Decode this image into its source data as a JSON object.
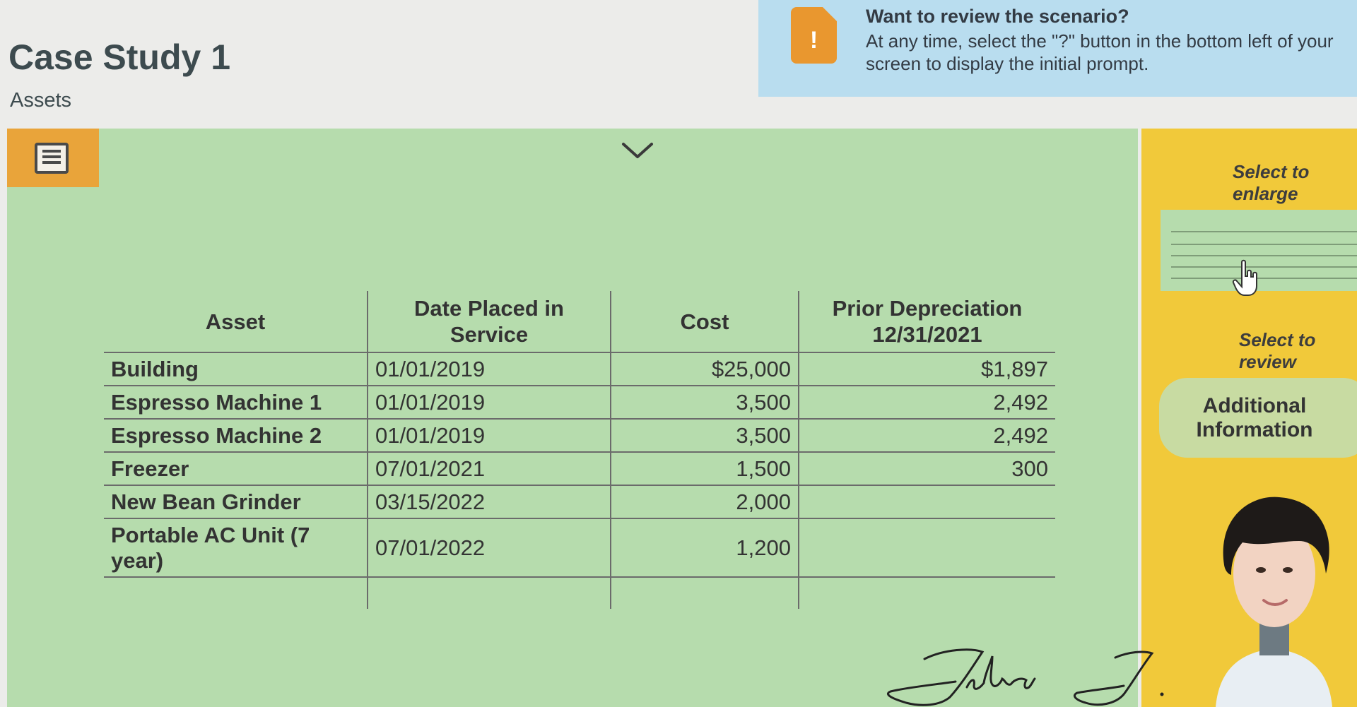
{
  "header": {
    "title": "Case Study 1",
    "subtitle": "Assets"
  },
  "notice": {
    "icon": "alert-document-icon",
    "icon_glyph": "!",
    "title": "Want to review the scenario?",
    "text": "At any time, select the \"?\" button in the bottom left of your screen to display the initial prompt."
  },
  "main": {
    "menu_icon": "document-menu-icon",
    "collapse_icon": "chevron-down-icon",
    "table": {
      "headers": [
        "Asset",
        "Date Placed in Service",
        "Cost",
        "Prior Depreciation 12/31/2021"
      ],
      "rows": [
        {
          "asset": "Building",
          "date": "01/01/2019",
          "cost": "$25,000",
          "prior": "$1,897"
        },
        {
          "asset": "Espresso Machine 1",
          "date": "01/01/2019",
          "cost": "3,500",
          "prior": "2,492"
        },
        {
          "asset": "Espresso Machine 2",
          "date": "01/01/2019",
          "cost": "3,500",
          "prior": "2,492"
        },
        {
          "asset": "Freezer",
          "date": "07/01/2021",
          "cost": "1,500",
          "prior": "300"
        },
        {
          "asset": "New Bean Grinder",
          "date": "03/15/2022",
          "cost": "2,000",
          "prior": ""
        },
        {
          "asset": "Portable AC Unit (7 year)",
          "date": "07/01/2022",
          "cost": "1,200",
          "prior": ""
        }
      ]
    },
    "signature": "Julia J."
  },
  "side": {
    "enlarge_label": "Select to enlarge",
    "review_label": "Select to review",
    "info_button": "Additional Information",
    "avatar": "person-avatar"
  },
  "colors": {
    "notice_bg": "#b9ddef",
    "accent_orange": "#e9972f",
    "table_panel": "#b6dcad",
    "side_panel": "#f1c93a",
    "info_button": "#c8dba2"
  }
}
